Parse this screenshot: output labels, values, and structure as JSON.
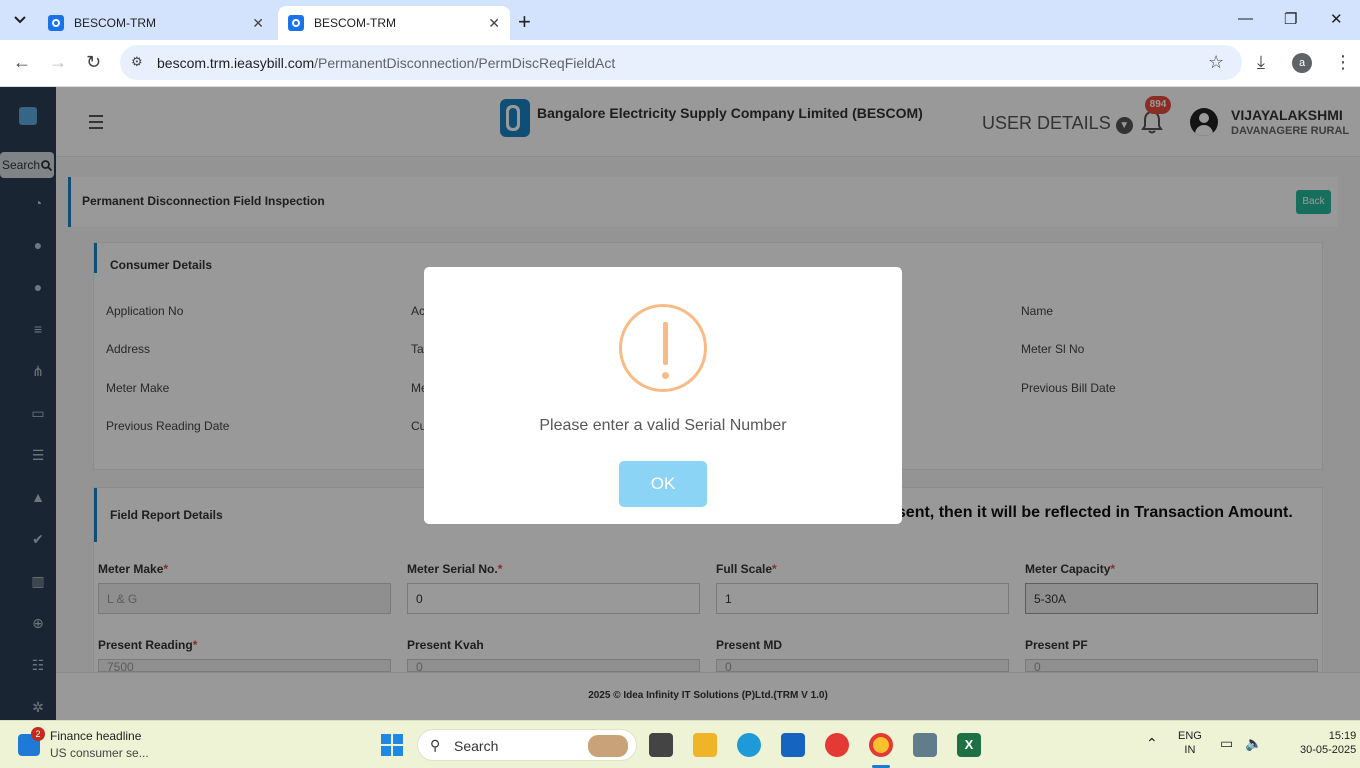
{
  "browser": {
    "tabs": [
      {
        "title": "BESCOM-TRM",
        "active": false
      },
      {
        "title": "BESCOM-TRM",
        "active": true
      }
    ],
    "url_host": "bescom.trm.ieasybill.com",
    "url_path": "/PermanentDisconnection/PermDiscReqFieldAct",
    "profile_initial": "a"
  },
  "sidebar": {
    "search_label": "Search"
  },
  "header": {
    "company": "Bangalore Electricity Supply Company Limited (BESCOM)",
    "user_details_label": "USER DETAILS",
    "notification_count": "894",
    "user_name": "VIJAYALAKSHMI",
    "user_location": "DAVANAGERE RURAL"
  },
  "page": {
    "title": "Permanent Disconnection Field Inspection",
    "back_label": "Back"
  },
  "consumer_details": {
    "title": "Consumer Details",
    "labels": [
      "Application No",
      "Ac",
      "Name",
      "Address",
      "Tar",
      "Meter Sl No",
      "Meter Make",
      "Me",
      "Previous Bill Date",
      "Previous Reading Date",
      "Cu"
    ]
  },
  "field_report": {
    "title": "Field Report Details",
    "notice": "esent, then it will be reflected in Transaction Amount.",
    "fields": [
      {
        "label": "Meter Make",
        "required": "*",
        "value": "L & G"
      },
      {
        "label": "Meter Serial No.",
        "required": "*",
        "value": "0"
      },
      {
        "label": "Full Scale",
        "required": "*",
        "value": "1"
      },
      {
        "label": "Meter Capacity",
        "required": "*",
        "value": "5-30A"
      },
      {
        "label": "Present Reading",
        "required": "*",
        "value": "7500"
      },
      {
        "label": "Present Kvah",
        "required": "",
        "value": "0"
      },
      {
        "label": "Present MD",
        "required": "",
        "value": "0"
      },
      {
        "label": "Present PF",
        "required": "",
        "value": "0"
      }
    ]
  },
  "footer": {
    "text": "2025 © Idea Infinity IT Solutions (P)Ltd.(TRM V 1.0)"
  },
  "dialog": {
    "message": "Please enter a valid Serial Number",
    "ok_label": "OK",
    "icon": "warning-icon",
    "ring_color": "#f8bb86",
    "button_color": "#8cd4f5"
  },
  "taskbar": {
    "widget_badge": "2",
    "news_title": "Finance headline",
    "news_sub": "US consumer se...",
    "search_label": "Search",
    "lang_1": "ENG",
    "lang_2": "IN",
    "time": "15:19",
    "date": "30-05-2025"
  }
}
